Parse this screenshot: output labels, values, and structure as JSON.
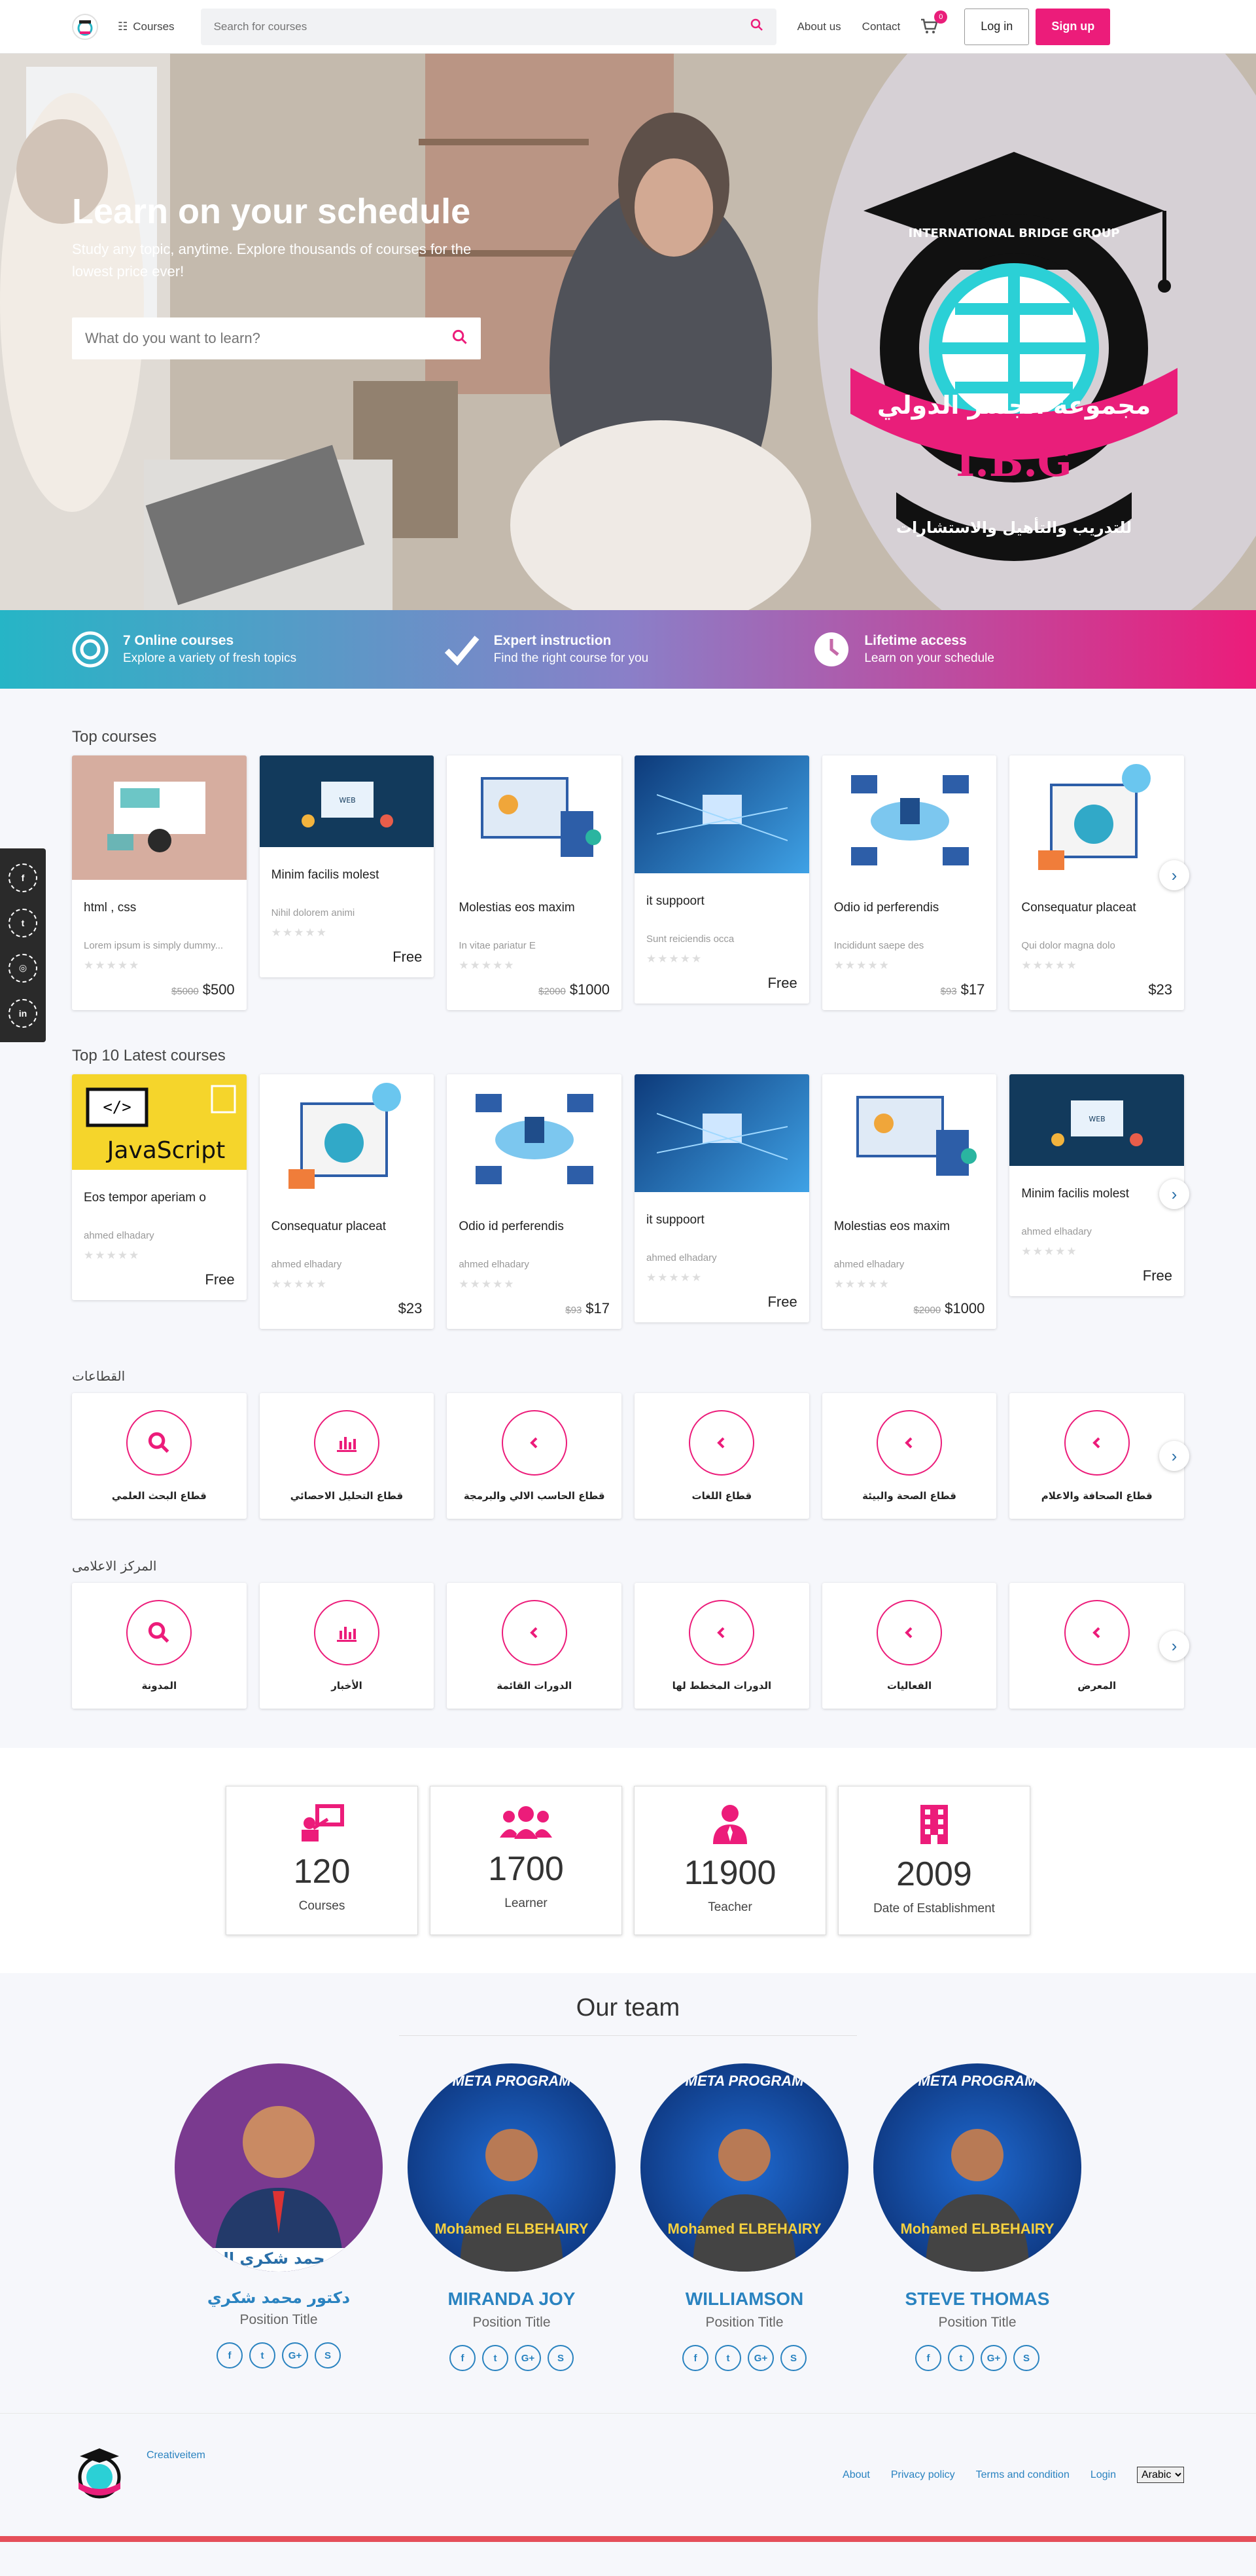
{
  "header": {
    "courses_label": "Courses",
    "search_placeholder": "Search for courses",
    "about": "About us",
    "contact": "Contact",
    "cart_count": "0",
    "login": "Log in",
    "signup": "Sign up"
  },
  "hero": {
    "title": "Learn on your schedule",
    "subtitle": "Study any topic, anytime. Explore thousands of courses for the lowest price ever!",
    "search_placeholder": "What do you want to learn?",
    "logo_arabic_main": "مجموعة الجسر الدولي",
    "logo_english": "INTERNATIONAL BRIDGE GROUP",
    "logo_abbr": "I.B.G",
    "logo_arabic_sub": "للتدريب والتأهيل والاستشارات"
  },
  "features": [
    {
      "title": "7 Online courses",
      "sub": "Explore a variety of fresh topics"
    },
    {
      "title": "Expert instruction",
      "sub": "Find the right course for you"
    },
    {
      "title": "Lifetime access",
      "sub": "Learn on your schedule"
    }
  ],
  "top_courses": {
    "title": "Top courses",
    "items": [
      {
        "title": "html , css",
        "desc": "Lorem ipsum is simply dummy...",
        "old_price": "$5000",
        "price": "$500"
      },
      {
        "title": "Minim facilis molest",
        "desc": "Nihil dolorem animi",
        "old_price": "",
        "price": "Free"
      },
      {
        "title": "Molestias eos maxim",
        "desc": "In vitae pariatur E",
        "old_price": "$2000",
        "price": "$1000"
      },
      {
        "title": "it suppoort",
        "desc": "Sunt reiciendis occa",
        "old_price": "",
        "price": "Free"
      },
      {
        "title": "Odio id perferendis",
        "desc": "Incididunt saepe des",
        "old_price": "$93",
        "price": "$17"
      },
      {
        "title": "Consequatur placeat",
        "desc": "Qui dolor magna dolo",
        "old_price": "",
        "price": "$23"
      }
    ]
  },
  "latest_courses": {
    "title": "Top 10 Latest courses",
    "items": [
      {
        "title": "Eos tempor aperiam o",
        "desc": "ahmed elhadary",
        "old_price": "",
        "price": "Free"
      },
      {
        "title": "Consequatur placeat",
        "desc": "ahmed elhadary",
        "old_price": "",
        "price": "$23"
      },
      {
        "title": "Odio id perferendis",
        "desc": "ahmed elhadary",
        "old_price": "$93",
        "price": "$17"
      },
      {
        "title": "it suppoort",
        "desc": "ahmed elhadary",
        "old_price": "",
        "price": "Free"
      },
      {
        "title": "Molestias eos maxim",
        "desc": "ahmed elhadary",
        "old_price": "$2000",
        "price": "$1000"
      },
      {
        "title": "Minim facilis molest",
        "desc": "ahmed elhadary",
        "old_price": "",
        "price": "Free"
      }
    ]
  },
  "sectors": {
    "title": "القطاعات",
    "items": [
      "قطاع البحث العلمي",
      "قطاع التحليل الاحصائي",
      "قطاع الحاسب الالي والبرمجة",
      "قطاع اللغات",
      "قطاع الصحة والبيئة",
      "قطاع الصحافة والاعلام"
    ]
  },
  "media": {
    "title": "المركز الاعلامى",
    "items": [
      "المدونة",
      "الأخبار",
      "الدورات القائمة",
      "الدورات المخطط لها",
      "الفعاليات",
      "المعرض"
    ]
  },
  "stats": [
    {
      "num": "120",
      "label": "Courses"
    },
    {
      "num": "1700",
      "label": "Learner"
    },
    {
      "num": "11900",
      "label": "Teacher"
    },
    {
      "num": "2009",
      "label": "Date of Establishment"
    }
  ],
  "team": {
    "title": "Our team",
    "members": [
      {
        "name": "دكتور محمد شكري",
        "position": "Position Title",
        "photo_caption": "د.محمد شكري الن"
      },
      {
        "name": "MIRANDA JOY",
        "position": "Position Title",
        "photo_caption": "META PROGRAM"
      },
      {
        "name": "WILLIAMSON",
        "position": "Position Title",
        "photo_caption": "META PROGRAM"
      },
      {
        "name": "STEVE THOMAS",
        "position": "Position Title",
        "photo_caption": "META PROGRAM"
      }
    ],
    "photo_subtitle": "Mohamed ELBEHAIRY"
  },
  "footer": {
    "brand": "Creativeitem",
    "about": "About",
    "privacy": "Privacy policy",
    "terms": "Terms and condition",
    "login": "Login",
    "language": "Arabic"
  },
  "social_labels": {
    "facebook": "f",
    "twitter": "t",
    "instagram": "◎",
    "linkedin": "in",
    "google": "G+",
    "skype": "S"
  },
  "colors": {
    "accent": "#ec1c7a",
    "teal": "#26b5c6",
    "link": "#2a83c0"
  }
}
